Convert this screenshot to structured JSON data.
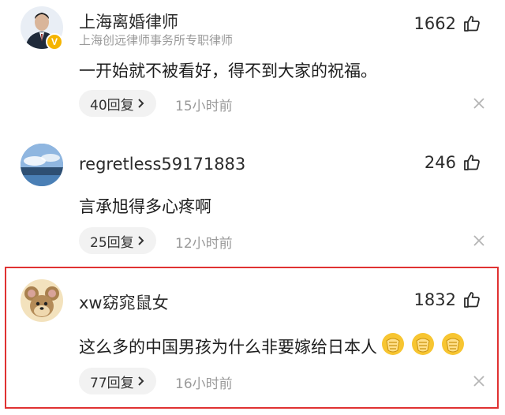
{
  "comments": [
    {
      "username": "上海离婚律师",
      "subtitle": "上海创远律师事务所专职律师",
      "likes": "1662",
      "text": "一开始就不被看好，得不到大家的祝福。",
      "replies": "40回复",
      "time": "15小时前"
    },
    {
      "username": "regretless59171883",
      "likes": "246",
      "text": "言承旭得多心疼啊",
      "replies": "25回复",
      "time": "12小时前"
    },
    {
      "username": "xw窈窕鼠女",
      "likes": "1832",
      "text": "这么多的中国男孩为什么非要嫁给日本人",
      "replies": "77回复",
      "time": "16小时前"
    }
  ],
  "icons": {
    "like": "thumbs-up-icon",
    "close": "close-icon",
    "chevron": "chevron-right-icon",
    "verified": "verified-badge-icon",
    "emoji": "clapping-emoji-icon"
  },
  "colors": {
    "highlight": "#e03232",
    "verified": "#f5b400"
  }
}
